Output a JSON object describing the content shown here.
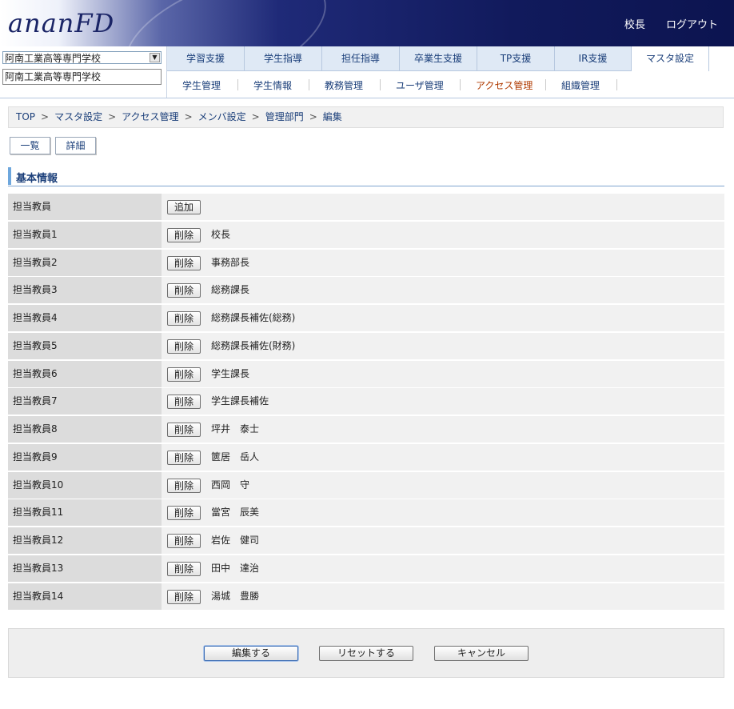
{
  "app": {
    "logo": "ananFD"
  },
  "header_links": {
    "user": "校長",
    "logout": "ログアウト"
  },
  "school": {
    "selected": "阿南工業高等専門学校",
    "name": "阿南工業高等専門学校"
  },
  "tabs": [
    {
      "label": "学習支援"
    },
    {
      "label": "学生指導"
    },
    {
      "label": "担任指導"
    },
    {
      "label": "卒業生支援"
    },
    {
      "label": "TP支援"
    },
    {
      "label": "IR支援"
    },
    {
      "label": "マスタ設定"
    }
  ],
  "subnav": [
    {
      "label": "学生管理"
    },
    {
      "label": "学生情報"
    },
    {
      "label": "教務管理"
    },
    {
      "label": "ユーザ管理"
    },
    {
      "label": "アクセス管理"
    },
    {
      "label": "組織管理"
    }
  ],
  "breadcrumb": [
    "TOP",
    "マスタ設定",
    "アクセス管理",
    "メンバ設定",
    "管理部門",
    "編集"
  ],
  "view_buttons": {
    "list": "一覧",
    "detail": "詳細"
  },
  "section_title": "基本情報",
  "add_row": {
    "label": "担当教員",
    "button": "追加"
  },
  "delete_label": "削除",
  "members": [
    {
      "label": "担当教員1",
      "name": "校長"
    },
    {
      "label": "担当教員2",
      "name": "事務部長"
    },
    {
      "label": "担当教員3",
      "name": "総務課長"
    },
    {
      "label": "担当教員4",
      "name": "総務課長補佐(総務)"
    },
    {
      "label": "担当教員5",
      "name": "総務課長補佐(財務)"
    },
    {
      "label": "担当教員6",
      "name": "学生課長"
    },
    {
      "label": "担当教員7",
      "name": "学生課長補佐"
    },
    {
      "label": "担当教員8",
      "name": "坪井　泰士"
    },
    {
      "label": "担当教員9",
      "name": "篋居　岳人"
    },
    {
      "label": "担当教員10",
      "name": "西岡　守"
    },
    {
      "label": "担当教員11",
      "name": "當宮　辰美"
    },
    {
      "label": "担当教員12",
      "name": "岩佐　健司"
    },
    {
      "label": "担当教員13",
      "name": "田中　達治"
    },
    {
      "label": "担当教員14",
      "name": "湯城　豊勝"
    }
  ],
  "footer": {
    "edit": "編集する",
    "reset": "リセットする",
    "cancel": "キャンセル"
  },
  "colors": {
    "header_dark": "#111a5c",
    "link": "#1b3f7a",
    "current_subnav": "#b03a00",
    "tab_bg": "#dfe9f5"
  }
}
